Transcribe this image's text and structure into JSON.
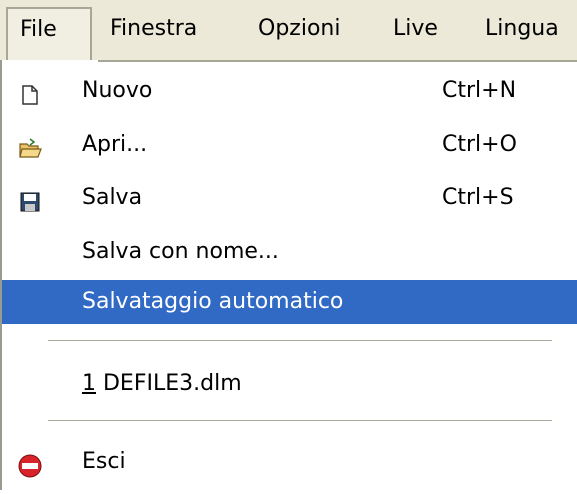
{
  "menubar": {
    "items": [
      {
        "label": "File",
        "active": true
      },
      {
        "label": "Finestra"
      },
      {
        "label": "Opzioni"
      },
      {
        "label": "Live"
      },
      {
        "label": "Lingua"
      }
    ]
  },
  "file_menu": {
    "items": [
      {
        "label": "Nuovo",
        "shortcut": "Ctrl+N",
        "icon": "new-document-icon"
      },
      {
        "label": "Apri...",
        "shortcut": "Ctrl+O",
        "icon": "open-folder-icon"
      },
      {
        "label": "Salva",
        "shortcut": "Ctrl+S",
        "icon": "save-floppy-icon"
      },
      {
        "label": "Salva con nome..."
      },
      {
        "label": "Salvataggio automatico",
        "highlighted": true
      }
    ],
    "recent": {
      "number": "1",
      "file": " DEFILE3.dlm"
    },
    "exit": {
      "label": "Esci",
      "icon": "exit-icon"
    }
  },
  "colors": {
    "highlight": "#316ac5",
    "menubar_bg": "#ece9d8",
    "separator": "#aca899"
  }
}
